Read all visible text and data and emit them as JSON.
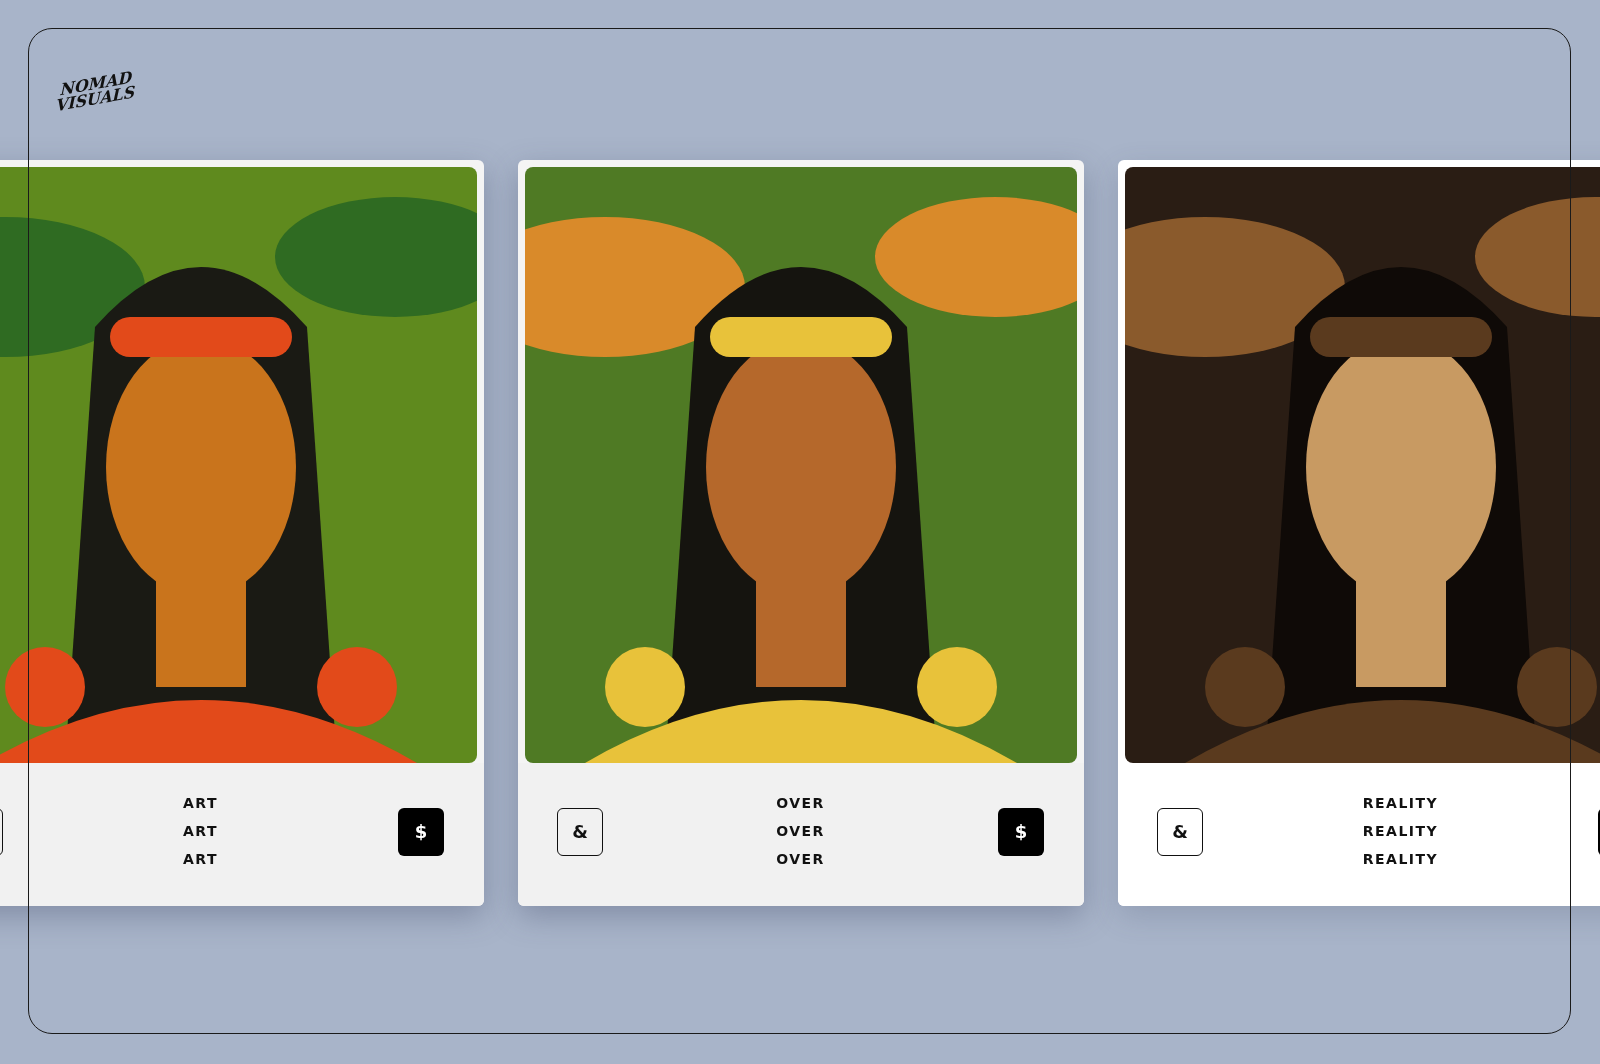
{
  "logo": {
    "lines": [
      "NOMAD",
      "VISUALS"
    ]
  },
  "cards": [
    {
      "selected": false,
      "caption": [
        "ART",
        "ART",
        "ART"
      ],
      "left_button": {
        "kind": "outline"
      },
      "right_button": {
        "kind": "solid",
        "label": "$"
      }
    },
    {
      "selected": false,
      "caption": [
        "OVER",
        "OVER",
        "OVER"
      ],
      "left_button": {
        "kind": "outline",
        "label": "&"
      },
      "right_button": {
        "kind": "solid",
        "label": "$"
      }
    },
    {
      "selected": true,
      "caption": [
        "REALITY",
        "REALITY",
        "REALITY"
      ],
      "left_button": {
        "kind": "outline",
        "label": "&"
      },
      "right_button": {
        "kind": "solid"
      }
    }
  ]
}
